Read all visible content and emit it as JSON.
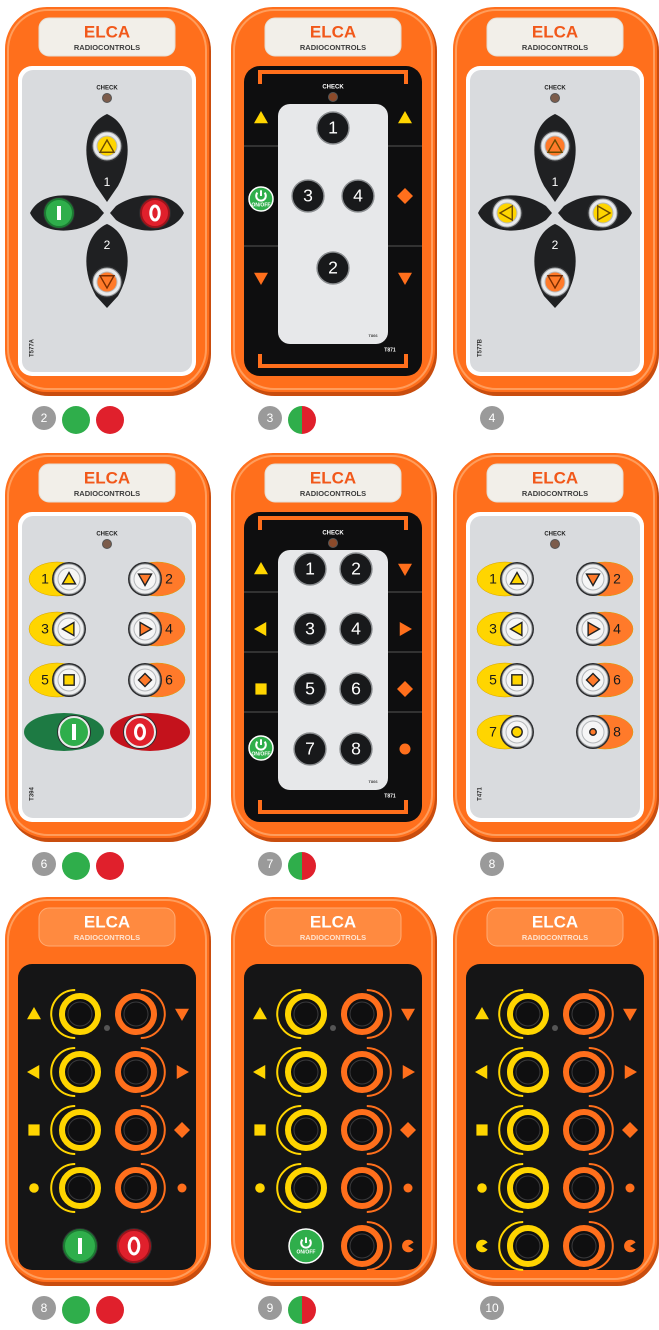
{
  "brand": {
    "name": "ELCA",
    "sub": "RADIOCONTROLS",
    "check_label": "CHECK",
    "onoff_label": "ON/OFF"
  },
  "colors": {
    "orange": "#ff6f1c",
    "green": "#2fae4b",
    "red": "#e0202c",
    "yellow": "#ffd500",
    "panel": "#d9dbde",
    "dark": "#1f2022",
    "badge": "#9a9a9a"
  },
  "remotes": [
    {
      "id": "T577A",
      "model": "T577A",
      "style": "cross-2",
      "buttons": 2,
      "power": "on-off",
      "badge": "2"
    },
    {
      "id": "T871-3",
      "model": "T871",
      "inner_model": "T866",
      "style": "numbered-3",
      "buttons": 3,
      "power": "toggle",
      "badge": "3"
    },
    {
      "id": "T577B",
      "model": "T577B",
      "style": "cross-4",
      "buttons": 4,
      "power": "none",
      "badge": "4"
    },
    {
      "id": "T394",
      "model": "T394",
      "style": "pairs-6",
      "buttons": 6,
      "power": "on-off",
      "badge": "6"
    },
    {
      "id": "T871-7",
      "model": "T871",
      "inner_model": "T866",
      "style": "numbered-7",
      "buttons": 7,
      "power": "toggle",
      "badge": "7"
    },
    {
      "id": "T471",
      "model": "T471",
      "style": "pairs-8",
      "buttons": 8,
      "power": "none",
      "badge": "8"
    },
    {
      "id": "dark-8",
      "style": "dark-8",
      "buttons": 8,
      "power": "on-off",
      "badge": "8"
    },
    {
      "id": "dark-9",
      "style": "dark-9",
      "buttons": 9,
      "power": "toggle",
      "badge": "9"
    },
    {
      "id": "dark-10",
      "style": "dark-10",
      "buttons": 10,
      "power": "none",
      "badge": "10"
    }
  ]
}
